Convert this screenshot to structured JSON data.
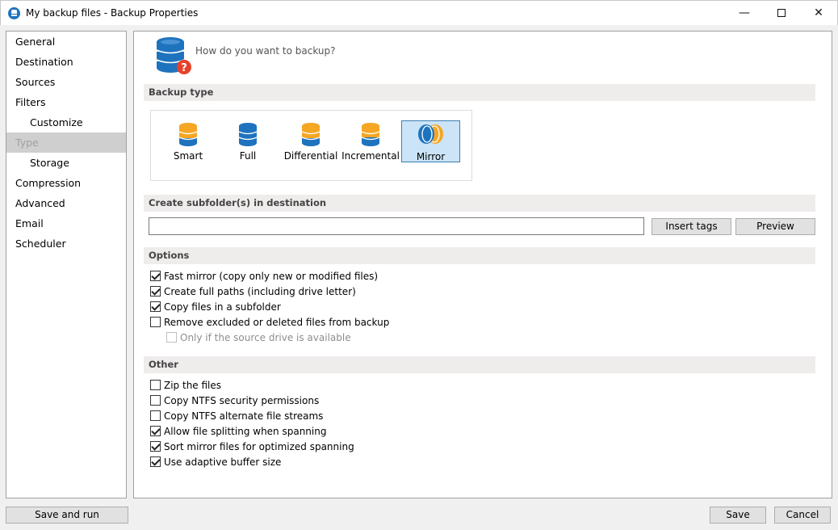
{
  "window": {
    "title": "My backup files - Backup Properties",
    "minimize_glyph": "—",
    "close_glyph": "✕"
  },
  "sidebar": {
    "items": [
      {
        "label": "General"
      },
      {
        "label": "Destination"
      },
      {
        "label": "Sources"
      },
      {
        "label": "Filters"
      },
      {
        "label": "Customize"
      },
      {
        "label": "Type"
      },
      {
        "label": "Storage"
      },
      {
        "label": "Compression"
      },
      {
        "label": "Advanced"
      },
      {
        "label": "Email"
      },
      {
        "label": "Scheduler"
      }
    ]
  },
  "header": {
    "question": "How do you want to backup?"
  },
  "backup_type": {
    "section_label": "Backup type",
    "options": [
      {
        "label": "Smart"
      },
      {
        "label": "Full"
      },
      {
        "label": "Differential"
      },
      {
        "label": "Incremental"
      },
      {
        "label": "Mirror"
      }
    ],
    "selected": "Mirror"
  },
  "subfolder": {
    "section_label": "Create subfolder(s) in destination",
    "value": "",
    "insert_tags_label": "Insert tags",
    "preview_label": "Preview"
  },
  "options": {
    "section_label": "Options",
    "items": [
      {
        "label": "Fast mirror (copy only new or modified files)",
        "checked": true
      },
      {
        "label": "Create full paths (including drive letter)",
        "checked": true
      },
      {
        "label": "Copy files in a subfolder",
        "checked": true
      },
      {
        "label": "Remove excluded or deleted files from backup",
        "checked": false
      },
      {
        "label": "Only if the source drive is available",
        "checked": false
      }
    ]
  },
  "other": {
    "section_label": "Other",
    "items": [
      {
        "label": "Zip the files",
        "checked": false
      },
      {
        "label": "Copy NTFS security permissions",
        "checked": false
      },
      {
        "label": "Copy NTFS alternate file streams",
        "checked": false
      },
      {
        "label": "Allow file splitting when spanning",
        "checked": true
      },
      {
        "label": "Sort mirror files for optimized spanning",
        "checked": true
      },
      {
        "label": "Use adaptive buffer size",
        "checked": true
      }
    ]
  },
  "footer": {
    "save_and_run_label": "Save and run",
    "save_label": "Save",
    "cancel_label": "Cancel"
  },
  "colors": {
    "accent_blue": "#1e73be",
    "accent_orange": "#f5a623",
    "alert_red": "#e8402a",
    "selection_bg": "#cce4f7"
  }
}
